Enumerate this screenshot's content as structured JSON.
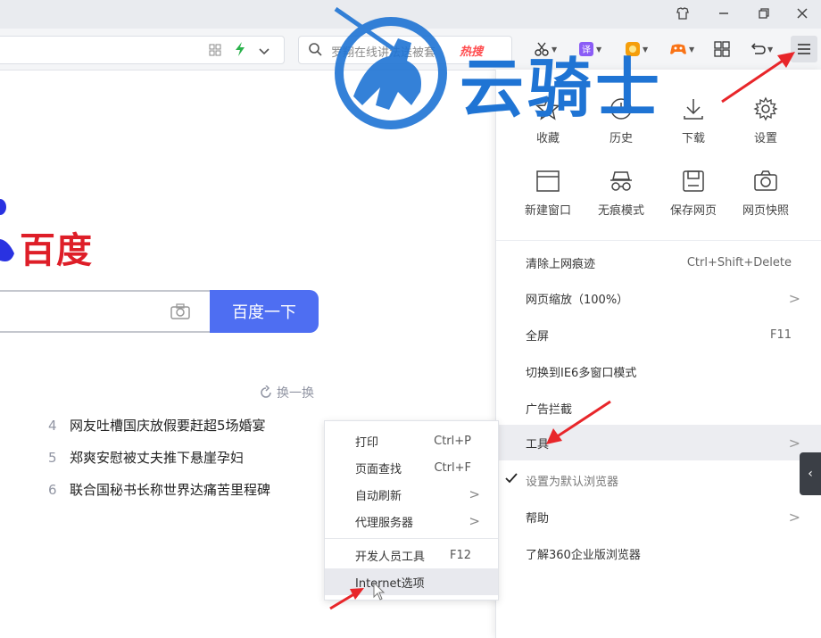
{
  "toolbar": {
    "search_placeholder": "罗翔在线讲法送被套",
    "hot_label": "热搜"
  },
  "page": {
    "logo_text": "百度",
    "search_button": "百度一下",
    "refresh_label": "换一换",
    "hot_list": [
      {
        "num": "4",
        "text": "网友吐槽国庆放假要赶超5场婚宴"
      },
      {
        "num": "5",
        "text": "郑爽安慰被丈夫推下悬崖孕妇"
      },
      {
        "num": "6",
        "text": "联合国秘书长称世界达痛苦里程碑"
      }
    ]
  },
  "menu": {
    "grid": [
      {
        "label": "收藏",
        "icon": "star-icon"
      },
      {
        "label": "历史",
        "icon": "clock-icon"
      },
      {
        "label": "下载",
        "icon": "download-icon"
      },
      {
        "label": "设置",
        "icon": "gear-icon"
      },
      {
        "label": "新建窗口",
        "icon": "window-icon"
      },
      {
        "label": "无痕模式",
        "icon": "incognito-icon"
      },
      {
        "label": "保存网页",
        "icon": "save-icon"
      },
      {
        "label": "网页快照",
        "icon": "camera-icon"
      }
    ],
    "items": [
      {
        "label": "清除上网痕迹",
        "shortcut": "Ctrl+Shift+Delete"
      },
      {
        "label": "网页缩放（100%）",
        "shortcut": ">"
      },
      {
        "label": "全屏",
        "shortcut": "F11"
      },
      {
        "label": "切换到IE6多窗口模式",
        "shortcut": ""
      },
      {
        "label": "广告拦截",
        "shortcut": ""
      },
      {
        "label": "工具",
        "shortcut": ">"
      },
      {
        "label": "设置为默认浏览器",
        "shortcut": ""
      },
      {
        "label": "帮助",
        "shortcut": ">"
      },
      {
        "label": "了解360企业版浏览器",
        "shortcut": ""
      }
    ]
  },
  "submenu": {
    "items": [
      {
        "label": "打印",
        "shortcut": "Ctrl+P"
      },
      {
        "label": "页面查找",
        "shortcut": "Ctrl+F"
      },
      {
        "label": "自动刷新",
        "shortcut": ">"
      },
      {
        "label": "代理服务器",
        "shortcut": ">"
      },
      {
        "label": "开发人员工具",
        "shortcut": "F12"
      },
      {
        "label": "Internet选项",
        "shortcut": ""
      }
    ]
  },
  "watermark": {
    "text": "云骑士"
  },
  "colors": {
    "accent": "#4e6ef2",
    "baidu_red": "#de1e28",
    "baidu_blue": "#2932e1",
    "annotation_red": "#e8262a",
    "watermark_blue": "#1f74d4"
  }
}
